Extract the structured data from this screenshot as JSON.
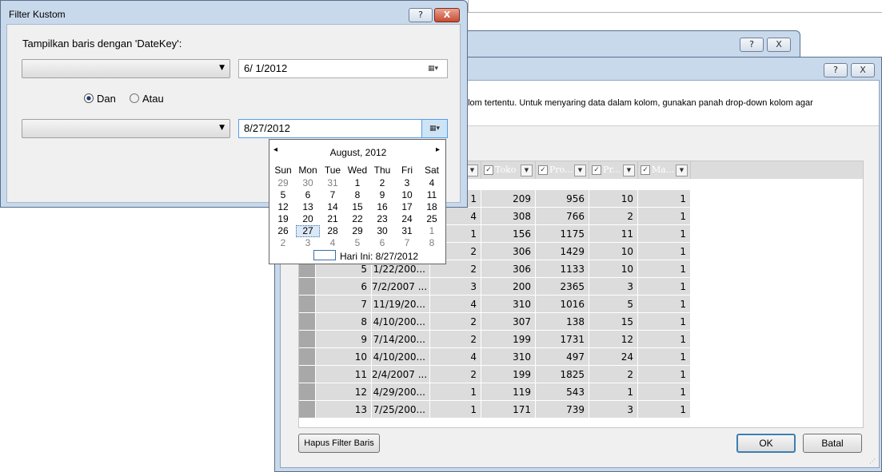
{
  "back_dialog": {
    "caption_buttons": {
      "help": "?",
      "close": "X"
    },
    "description": "olom tertentu. Untuk menyaring data dalam kolom, gunakan panah drop-down kolom agar",
    "columns": [
      "",
      "",
      "Toko",
      "Pro...",
      "Pr...",
      "Ma..."
    ],
    "rows": [
      [
        "",
        "",
        "1",
        "209",
        "956",
        "10",
        "1"
      ],
      [
        "",
        "",
        "4",
        "308",
        "766",
        "2",
        "1"
      ],
      [
        "",
        "",
        "1",
        "156",
        "1175",
        "11",
        "1"
      ],
      [
        "",
        "",
        "2",
        "306",
        "1429",
        "10",
        "1"
      ],
      [
        "5",
        "1/22/200...",
        "2",
        "306",
        "1133",
        "10",
        "1"
      ],
      [
        "6",
        "7/2/2007 ...",
        "3",
        "200",
        "2365",
        "3",
        "1"
      ],
      [
        "7",
        "11/19/20...",
        "4",
        "310",
        "1016",
        "5",
        "1"
      ],
      [
        "8",
        "4/10/200...",
        "2",
        "307",
        "138",
        "15",
        "1"
      ],
      [
        "9",
        "7/14/200...",
        "2",
        "199",
        "1731",
        "12",
        "1"
      ],
      [
        "10",
        "4/10/200...",
        "4",
        "310",
        "497",
        "24",
        "1"
      ],
      [
        "11",
        "2/4/2007 ...",
        "2",
        "199",
        "1825",
        "2",
        "1"
      ],
      [
        "12",
        "4/29/200...",
        "1",
        "119",
        "543",
        "1",
        "1"
      ],
      [
        "13",
        "7/25/200...",
        "1",
        "171",
        "739",
        "3",
        "1"
      ]
    ],
    "clear_button": "Hapus Filter Baris",
    "ok_button": "OK",
    "cancel_button": "Batal"
  },
  "filter_dialog": {
    "title": "Filter Kustom",
    "caption_buttons": {
      "help": "?",
      "close": "X"
    },
    "instruction": "Tampilkan baris dengan 'DateKey':",
    "value1": "6/  1/2012",
    "value2": "8/27/2012",
    "radio_and": "Dan",
    "radio_or": "Atau",
    "selected_radio": "Dan"
  },
  "calendar": {
    "month_label": "August, 2012",
    "prev": "◂",
    "next": "▸",
    "weekdays": [
      "Sun",
      "Mon",
      "Tue",
      "Wed",
      "Thu",
      "Fri",
      "Sat"
    ],
    "weeks": [
      [
        "29",
        "30",
        "31",
        "1",
        "2",
        "3",
        "4"
      ],
      [
        "5",
        "6",
        "7",
        "8",
        "9",
        "10",
        "11"
      ],
      [
        "12",
        "13",
        "14",
        "15",
        "16",
        "17",
        "18"
      ],
      [
        "19",
        "20",
        "21",
        "22",
        "23",
        "24",
        "25"
      ],
      [
        "26",
        "27",
        "28",
        "29",
        "30",
        "31",
        "1"
      ],
      [
        "2",
        "3",
        "4",
        "5",
        "6",
        "7",
        "8"
      ]
    ],
    "selected_day": "27",
    "today_label": "Hari Ini: 8/27/2012",
    "colors": {
      "selected_border": "#3a6ea5",
      "other_month": "#808080"
    }
  },
  "icons": {
    "calendar_dropdown": "calendar-icon",
    "combo_arrow": "dropdown-arrow-icon",
    "checkbox": "checkbox-icon"
  }
}
